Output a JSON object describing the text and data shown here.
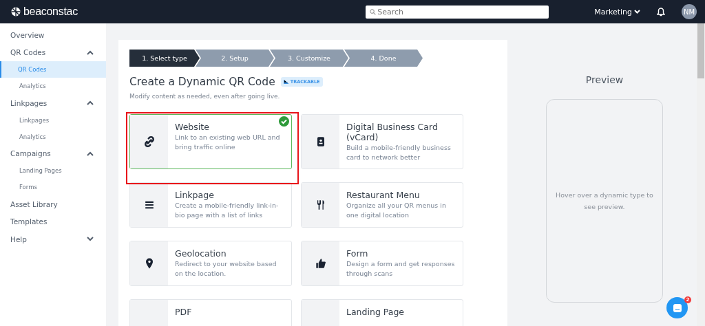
{
  "topbar": {
    "logo": "beaconstac",
    "search": {
      "placeholder": "Search"
    },
    "account": "Marketing",
    "avatar": "NM"
  },
  "sidebar": {
    "items": [
      {
        "label": "Overview"
      },
      {
        "label": "QR Codes",
        "expanded": true,
        "children": [
          {
            "label": "QR Codes",
            "selected": true
          },
          {
            "label": "Analytics",
            "selected": false
          }
        ]
      },
      {
        "label": "Linkpages",
        "expanded": true,
        "children": [
          {
            "label": "Linkpages",
            "selected": false
          },
          {
            "label": "Analytics",
            "selected": false
          }
        ]
      },
      {
        "label": "Campaigns",
        "expanded": true,
        "children": [
          {
            "label": "Landing Pages",
            "selected": false
          },
          {
            "label": "Forms",
            "selected": false
          }
        ]
      },
      {
        "label": "Asset Library"
      },
      {
        "label": "Templates"
      },
      {
        "label": "Help",
        "expanded": false
      }
    ]
  },
  "steps": [
    {
      "label": "1. Select type",
      "selected": true
    },
    {
      "label": "2. Setup",
      "selected": false
    },
    {
      "label": "3. Customize",
      "selected": false
    },
    {
      "label": "4. Done",
      "selected": false
    }
  ],
  "heading": "Create a Dynamic QR Code",
  "badge": "TRACKABLE",
  "subtitle": "Modify content as needed, even after going live.",
  "types": [
    {
      "title": "Website",
      "description": "Link to an existing web URL and bring traffic online",
      "selected": true
    },
    {
      "title": "Digital Business Card (vCard)",
      "description": "Build a mobile-friendly business card to network better",
      "selected": false
    },
    {
      "title": "Linkpage",
      "description": "Create a mobile-friendly link-in-bio page with a list of links",
      "selected": false
    },
    {
      "title": "Restaurant Menu",
      "description": "Organize all your QR menus in one digital location",
      "selected": false
    },
    {
      "title": "Geolocation",
      "description": "Redirect to your website based on the location.",
      "selected": false
    },
    {
      "title": "Form",
      "description": "Design a form and get responses through scans",
      "selected": false
    },
    {
      "title": "PDF",
      "selected": false
    },
    {
      "title": "Landing Page",
      "selected": false
    }
  ],
  "preview": {
    "title": "Preview",
    "hint": "Hover over a dynamic type to see preview."
  },
  "chat": {
    "count": "2"
  }
}
